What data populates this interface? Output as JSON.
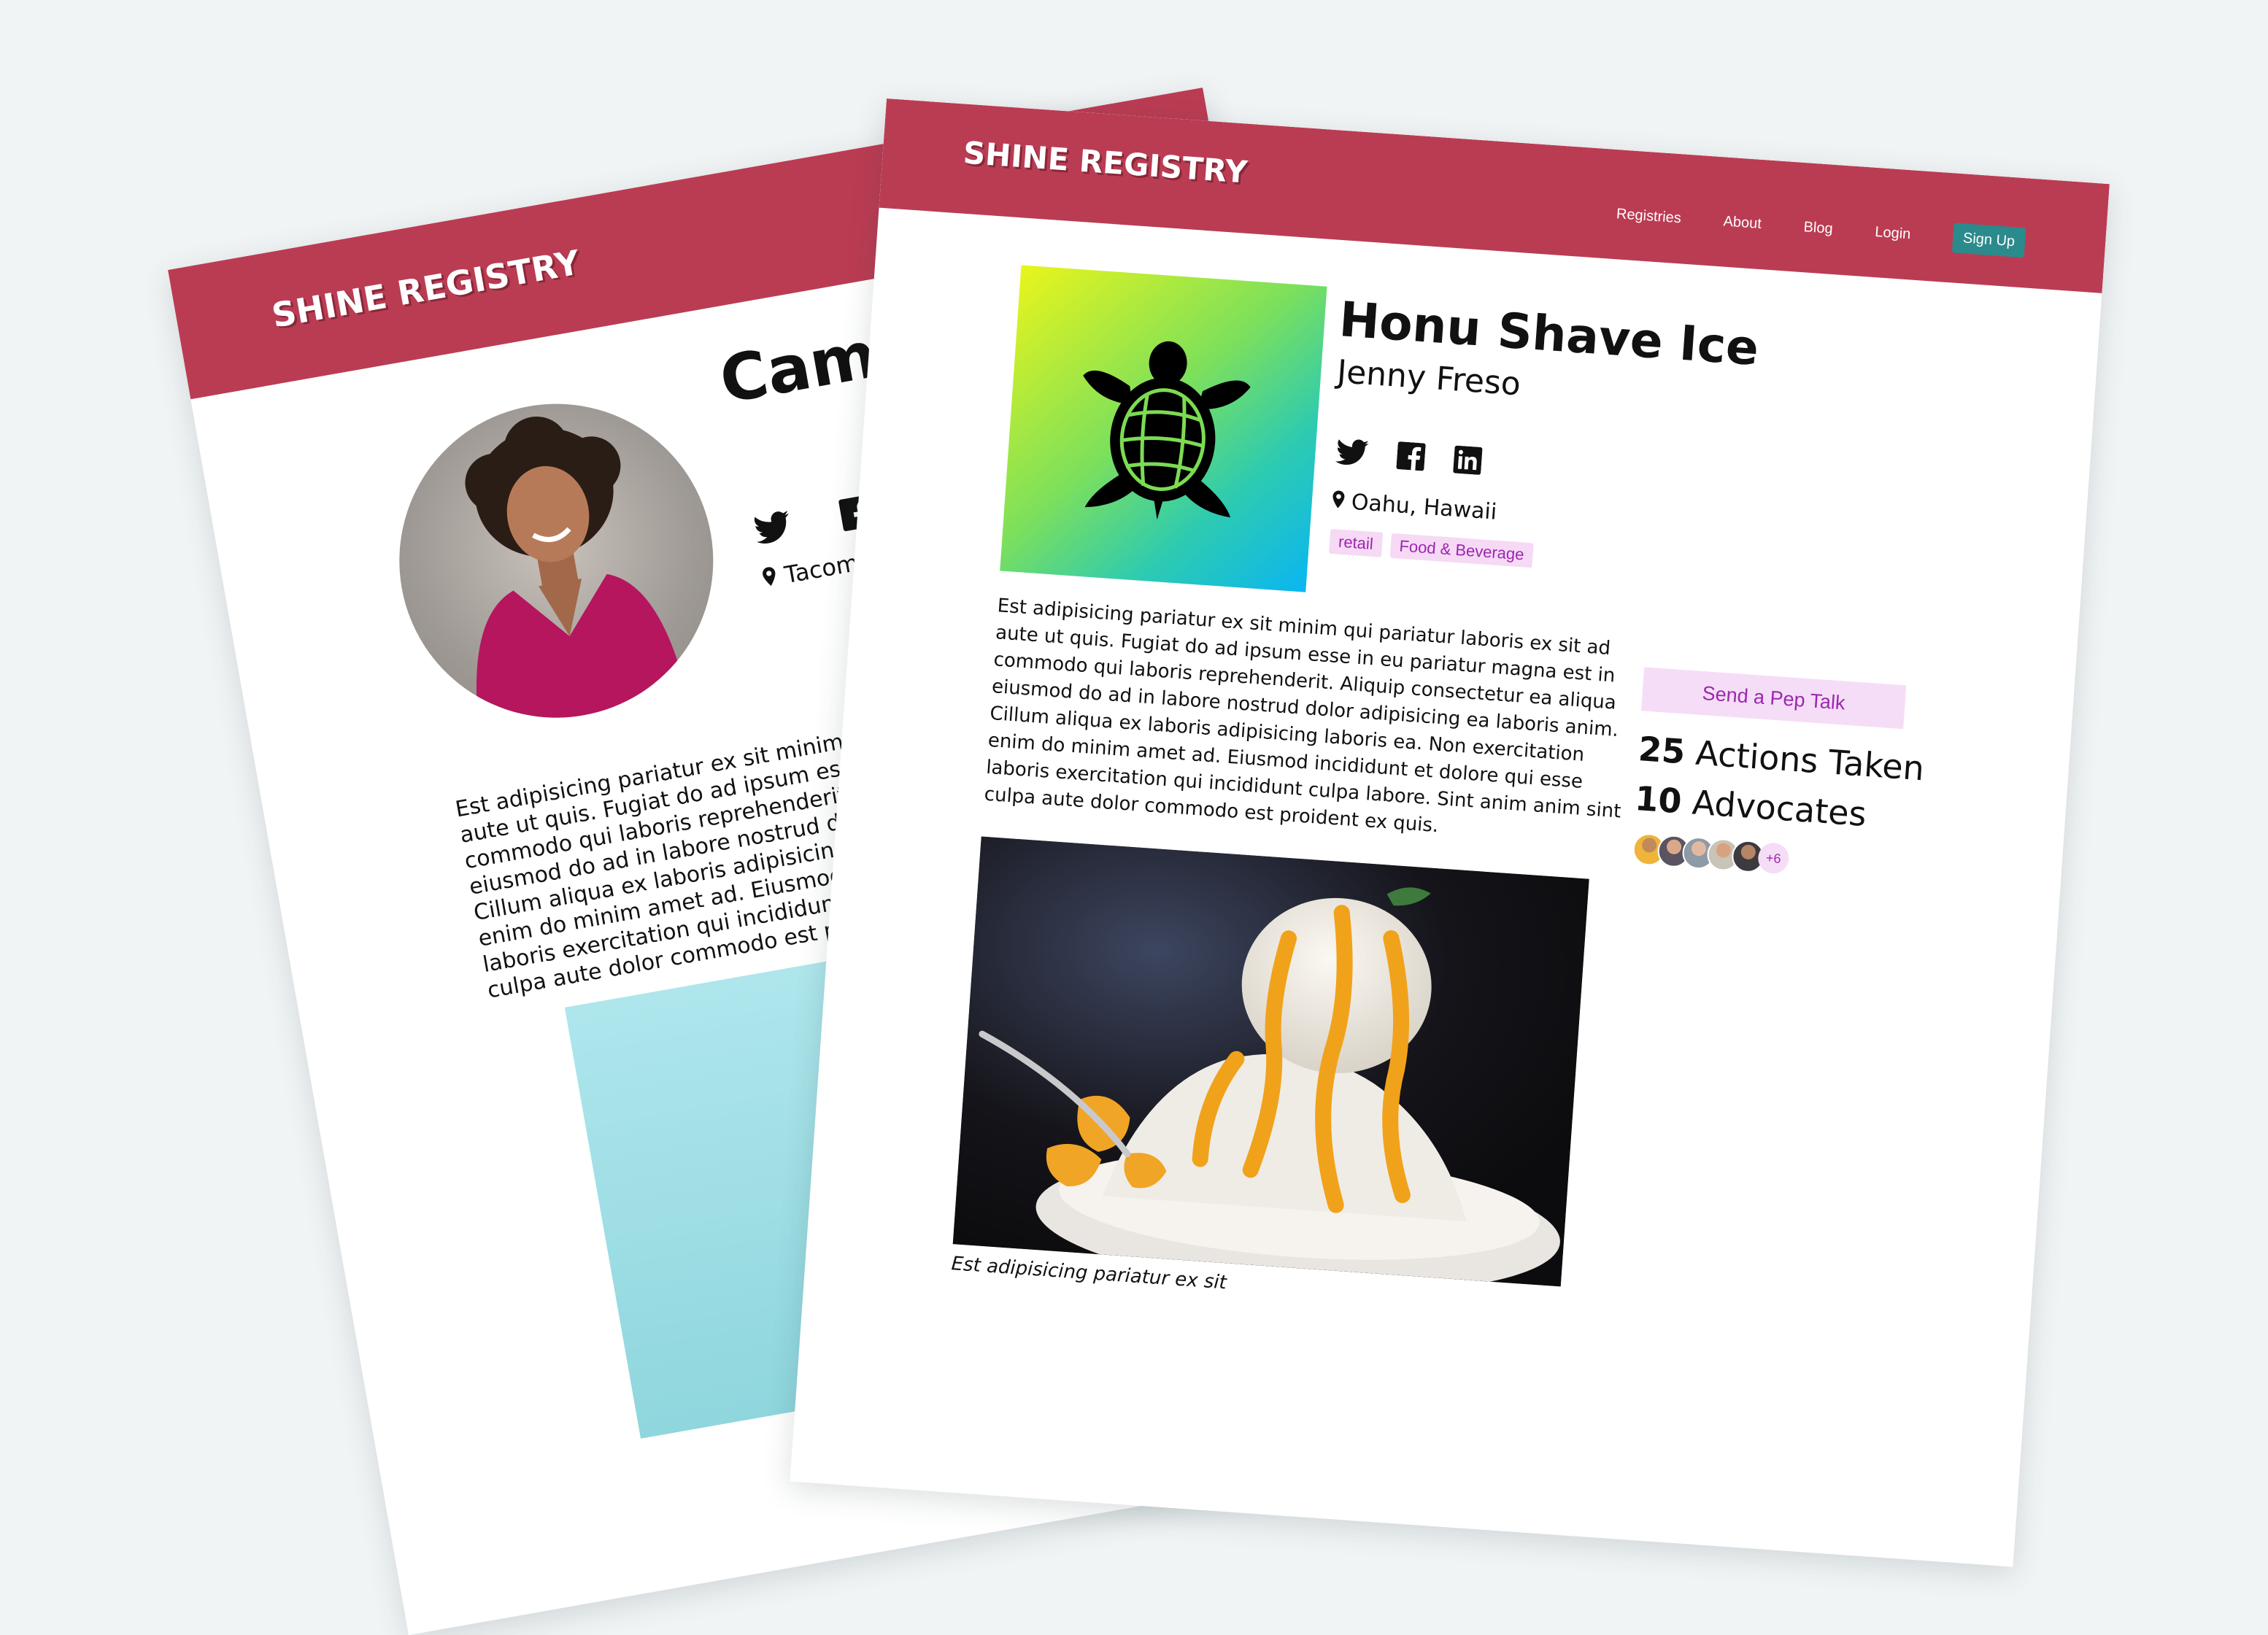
{
  "back_page": {
    "logo": "SHINE REGISTRY",
    "name": "Camer",
    "location": "Tacoma, V",
    "socials": [
      "twitter-icon",
      "facebook-icon"
    ],
    "body_lines": [
      "Est adipisicing pariatur ex sit minim qui pa",
      "aute ut quis. Fugiat do ad ipsum esse in e",
      "commodo qui laboris reprehenderit. Aliq",
      "eiusmod do ad in labore nostrud dolor a",
      "Cillum aliqua ex laboris adipisicing labo",
      "enim do minim amet ad. Eiusmod inci",
      "laboris exercitation qui incididunt culp",
      "culpa aute dolor commodo est proide"
    ]
  },
  "front_page": {
    "logo": "SHINE REGISTRY",
    "nav": {
      "registries": "Registries",
      "about": "About",
      "blog": "Blog",
      "login": "Login",
      "signup": "Sign Up"
    },
    "business_name": "Honu Shave Ice",
    "owner": "Jenny Freso",
    "socials": [
      "twitter-icon",
      "facebook-icon",
      "linkedin-icon"
    ],
    "location": "Oahu, Hawaii",
    "tags": [
      "retail",
      "Food & Beverage"
    ],
    "description_lines": [
      "Est adipisicing pariatur ex sit minim qui pariatur laboris ex sit ad",
      "aute ut quis. Fugiat do ad ipsum esse in eu pariatur magna est in",
      "commodo qui laboris reprehenderit. Aliquip consectetur ea aliqua",
      "eiusmod do ad in labore nostrud dolor adipisicing ea laboris anim.",
      "Cillum aliqua ex laboris adipisicing laboris ea. Non exercitation",
      "enim do minim amet ad. Eiusmod incididunt et dolore qui esse",
      "laboris exercitation qui incididunt culpa labore. Sint anim anim sint",
      "culpa aute dolor commodo est proident ex quis."
    ],
    "pep_talk": "Send a Pep Talk",
    "actions": {
      "count": "25",
      "label": "Actions Taken"
    },
    "advocates": {
      "count": "10",
      "label": "Advocates",
      "more": "+6"
    },
    "photo_caption": "Est adipisicing pariatur ex sit"
  },
  "colors": {
    "header": "#ba3c53",
    "signup": "#2b8a8c",
    "tag_bg": "#f6d9f5",
    "tag_text": "#9c26b0",
    "background": "#f1f4f5"
  }
}
